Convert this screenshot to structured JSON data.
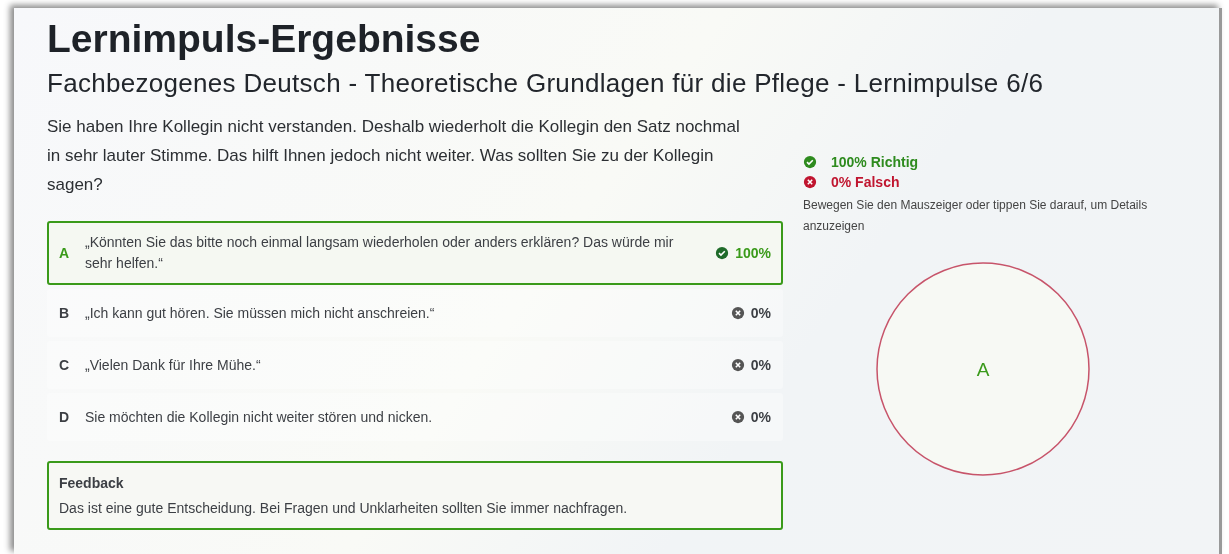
{
  "title": "Lernimpuls-Ergebnisse",
  "subtitle": "Fachbezogenes Deutsch - Theoretische Grundlagen für die Pflege  - Lernimpulse 6/6",
  "question": "Sie haben Ihre Kollegin nicht verstanden. Deshalb wiederholt die Kollegin den Satz nochmal in sehr lauter Stimme. Das hilft Ihnen jedoch nicht weiter. Was sollten Sie zu der Kollegin sagen?",
  "options": [
    {
      "letter": "A",
      "text": "„Könnten Sie das bitte noch einmal langsam wiederholen oder anders erklären? Das würde mir sehr helfen.“",
      "percent": "100%",
      "correct": true,
      "selected": true
    },
    {
      "letter": "B",
      "text": "„Ich kann gut hören. Sie müssen mich nicht anschreien.“",
      "percent": "0%",
      "correct": false,
      "selected": false
    },
    {
      "letter": "C",
      "text": "„Vielen Dank für Ihre Mühe.“",
      "percent": "0%",
      "correct": false,
      "selected": false
    },
    {
      "letter": "D",
      "text": "Sie möchten die Kollegin nicht weiter stören und nicken.",
      "percent": "0%",
      "correct": false,
      "selected": false
    }
  ],
  "feedback": {
    "title": "Feedback",
    "text": "Das ist eine gute Entscheidung. Bei Fragen und Unklarheiten sollten Sie immer nachfragen."
  },
  "legend": [
    {
      "kind": "correct",
      "text": "100% Richtig",
      "color": "#2e8b1e"
    },
    {
      "kind": "wrong",
      "text": "0% Falsch",
      "color": "#c0152f"
    }
  ],
  "hint": "Bewegen Sie den Mauszeiger oder tippen Sie darauf, um Details anzuzeigen",
  "chart_data": {
    "type": "pie",
    "categories": [
      "A"
    ],
    "values": [
      100
    ]
  }
}
